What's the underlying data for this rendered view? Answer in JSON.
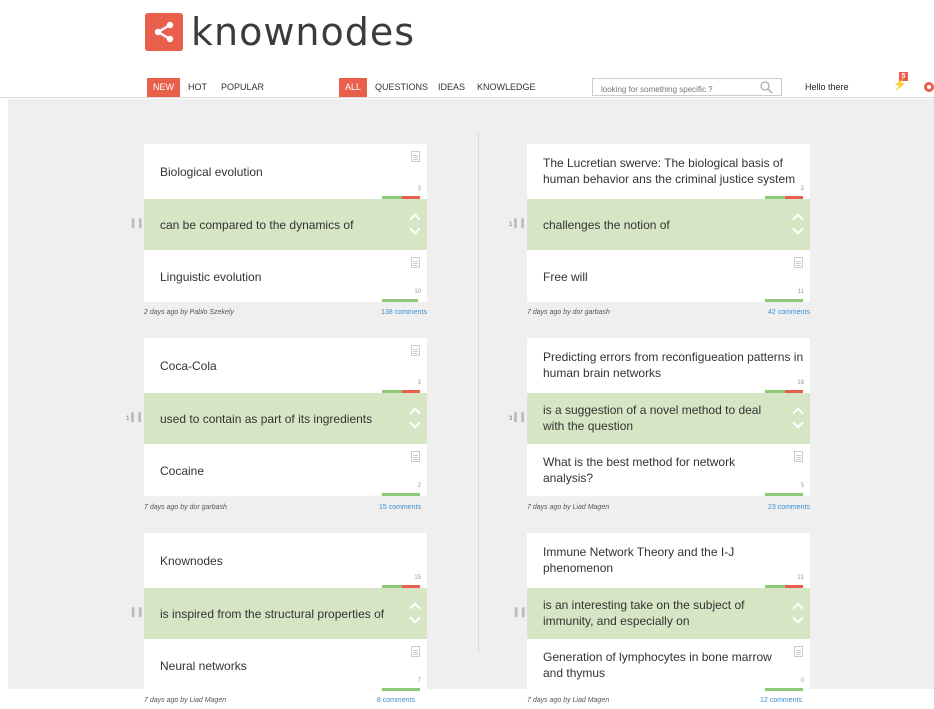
{
  "header": {
    "logo_text": "knownodes",
    "sort_tabs": [
      "NEW",
      "HOT",
      "POPULAR"
    ],
    "filter_tabs": [
      "ALL",
      "QUESTIONS",
      "IDEAS",
      "KNOWLEDGE"
    ],
    "search_placeholder": "looking for something specific ?",
    "greeting": "Hello there",
    "notification_count": "5"
  },
  "colors": {
    "accent": "#e8604c",
    "link_bg": "#d6e5c3",
    "comments": "#3b8fd4",
    "bar_green": "#8dc877"
  },
  "cards": [
    {
      "from_title": "Biological evolution",
      "from_count": "3",
      "link_text": "can be compared to the dynamics of",
      "link_handle_num": "",
      "to_title": "Linguistic evolution",
      "to_count": "10",
      "meta": "2 days ago by Pablo Szekely",
      "comments": "138 comments"
    },
    {
      "from_title": "The Lucretian swerve: The biological basis of human behavior ans the criminal justice system",
      "from_count": "2",
      "link_text": "challenges the notion of",
      "link_handle_num": "1",
      "to_title": "Free will",
      "to_count": "11",
      "meta": "7 days ago by dor garbash",
      "comments": "42 comments"
    },
    {
      "from_title": "Coca-Cola",
      "from_count": "3",
      "link_text": "used to contain as part of its ingredients",
      "link_handle_num": "1",
      "to_title": "Cocaine",
      "to_count": "2",
      "meta": "7 days ago by dor garbash",
      "comments": "15 comments"
    },
    {
      "from_title": "Predicting errors from reconfigueation patterns in human brain networks",
      "from_count": "18",
      "link_text": "is a suggestion of a novel method to deal with the question",
      "link_handle_num": "3",
      "to_title": "What is the best method for network analysis?",
      "to_count": "5",
      "meta": "7 days ago by Liad Magen",
      "comments": "23 comments"
    },
    {
      "from_title": "Knownodes",
      "from_count": "15",
      "link_text": "is inspired from the structural properties of",
      "link_handle_num": "",
      "to_title": "Neural networks",
      "to_count": "7",
      "meta": "7 days ago by Liad Magen",
      "comments": "8 comments"
    },
    {
      "from_title": "Immune Network Theory and the I-J phenomenon",
      "from_count": "21",
      "link_text": "is an interesting take on the subject of immunity, and especially on",
      "link_handle_num": "",
      "to_title": "Generation of lymphocytes in bone marrow and thymus",
      "to_count": "0",
      "meta": "7 days ago by Liad Magen",
      "comments": "12 comments"
    }
  ]
}
